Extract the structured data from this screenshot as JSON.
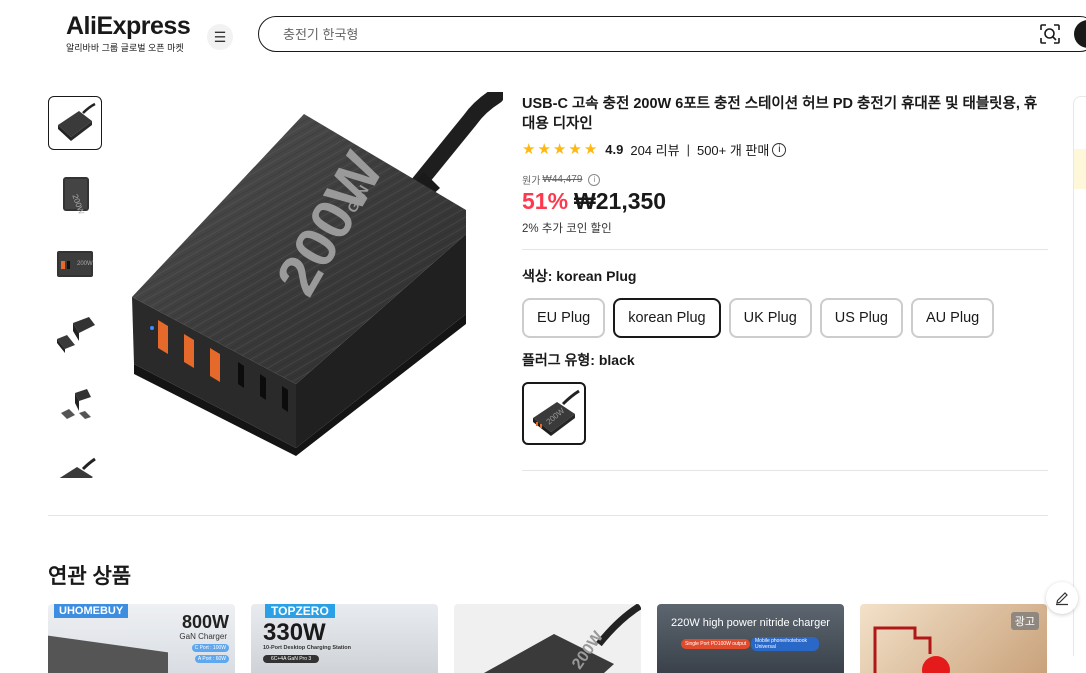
{
  "header": {
    "logo": "AliExpress",
    "logo_sub": "알리바바 그룹 글로벌 오픈 마켓",
    "search_placeholder": "충전기 한국형"
  },
  "product": {
    "title": "USB-C 고속 충전 200W 6포트 충전 스테이션 허브 PD 충전기 휴대폰 및 태블릿용, 휴대용 디자인",
    "rating": "4.9",
    "reviews": "204 리뷰",
    "sold": "500+ 개 판매",
    "original_label": "원가",
    "original_price": "₩44,479",
    "discount": "51%",
    "price": "₩21,350",
    "coin_note": "2% 추가 코인 할인",
    "color_label": "색상: korean Plug",
    "color_options": [
      "EU Plug",
      "korean Plug",
      "UK Plug",
      "US Plug",
      "AU Plug"
    ],
    "selected_color": "korean Plug",
    "plug_label": "플러그 유형: black",
    "image_text": "200W",
    "image_brand": "GaN"
  },
  "related": {
    "title": "연관 상품",
    "cards": [
      {
        "brand": "UHOMEBUY",
        "headline": "800W",
        "sub": "GaN Charger",
        "tag1": "C Port : 100W",
        "tag2": "A Port : 60W"
      },
      {
        "brand": "TOPZERO",
        "headline": "330W",
        "sub": "10-Port Desktop Charging Station",
        "tag": "6C+4A  GaN Pro 3"
      },
      {
        "image_text": "200W"
      },
      {
        "headline": "220W high power nitride charger",
        "tag1": "Single Port PD100W output",
        "tag2": "Mobile phone/notebook Universal"
      },
      {
        "ad": "광고"
      }
    ]
  },
  "colors": {
    "accent": "#fd384f",
    "star": "#fdb811",
    "text": "#191919"
  }
}
